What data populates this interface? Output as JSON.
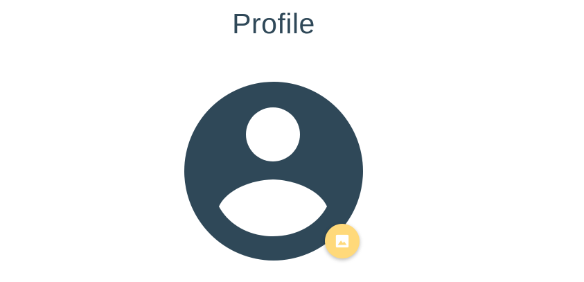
{
  "header": {
    "title": "Profile"
  },
  "avatar": {
    "icon": "account-circle-icon",
    "color": "#2f4858"
  },
  "upload_button": {
    "icon": "image-icon",
    "color": "#ffd97a"
  },
  "colors": {
    "title": "#2f4858",
    "background": "#ffffff"
  }
}
